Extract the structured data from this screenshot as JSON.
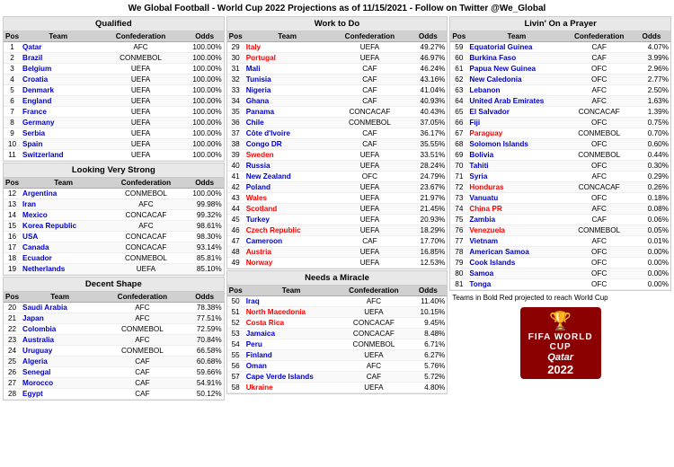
{
  "title": "We Global Football - World Cup 2022 Projections as of 11/15/2021 - Follow on Twitter @We_Global",
  "sections": {
    "qualified": {
      "header": "Qualified",
      "columns": [
        "Pos",
        "Team",
        "Confederation",
        "Odds"
      ],
      "rows": [
        [
          1,
          "Qatar",
          "AFC",
          "100.00%"
        ],
        [
          2,
          "Brazil",
          "CONMEBOL",
          "100.00%"
        ],
        [
          3,
          "Belgium",
          "UEFA",
          "100.00%"
        ],
        [
          4,
          "Croatia",
          "UEFA",
          "100.00%"
        ],
        [
          5,
          "Denmark",
          "UEFA",
          "100.00%"
        ],
        [
          6,
          "England",
          "UEFA",
          "100.00%"
        ],
        [
          7,
          "France",
          "UEFA",
          "100.00%"
        ],
        [
          8,
          "Germany",
          "UEFA",
          "100.00%"
        ],
        [
          9,
          "Serbia",
          "UEFA",
          "100.00%"
        ],
        [
          10,
          "Spain",
          "UEFA",
          "100.00%"
        ],
        [
          11,
          "Switzerland",
          "UEFA",
          "100.00%"
        ]
      ]
    },
    "looking_very_strong": {
      "header": "Looking Very Strong",
      "columns": [
        "Pos",
        "Team",
        "Confederation",
        "Odds"
      ],
      "rows": [
        [
          12,
          "Argentina",
          "CONMEBOL",
          "100.00%"
        ],
        [
          13,
          "Iran",
          "AFC",
          "99.98%"
        ],
        [
          14,
          "Mexico",
          "CONCACAF",
          "99.32%"
        ],
        [
          15,
          "Korea Republic",
          "AFC",
          "98.61%"
        ],
        [
          16,
          "USA",
          "CONCACAF",
          "98.30%"
        ],
        [
          17,
          "Canada",
          "CONCACAF",
          "93.14%"
        ],
        [
          18,
          "Ecuador",
          "CONMEBOL",
          "85.81%"
        ],
        [
          19,
          "Netherlands",
          "UEFA",
          "85.10%"
        ]
      ]
    },
    "decent_shape": {
      "header": "Decent Shape",
      "columns": [
        "Pos",
        "Team",
        "Confederation",
        "Odds"
      ],
      "rows": [
        [
          20,
          "Saudi Arabia",
          "AFC",
          "78.38%"
        ],
        [
          21,
          "Japan",
          "AFC",
          "77.51%"
        ],
        [
          22,
          "Colombia",
          "CONMEBOL",
          "72.59%"
        ],
        [
          23,
          "Australia",
          "AFC",
          "70.84%"
        ],
        [
          24,
          "Uruguay",
          "CONMEBOL",
          "66.58%"
        ],
        [
          25,
          "Algeria",
          "CAF",
          "60.68%"
        ],
        [
          26,
          "Senegal",
          "CAF",
          "59.66%"
        ],
        [
          27,
          "Morocco",
          "CAF",
          "54.91%"
        ],
        [
          28,
          "Egypt",
          "CAF",
          "50.12%"
        ]
      ]
    },
    "work_to_do": {
      "header": "Work to Do",
      "columns": [
        "Pos",
        "Team",
        "Confederation",
        "Odds"
      ],
      "rows": [
        [
          29,
          "Italy",
          "UEFA",
          "49.27%"
        ],
        [
          30,
          "Portugal",
          "UEFA",
          "46.97%"
        ],
        [
          31,
          "Mali",
          "CAF",
          "46.24%"
        ],
        [
          32,
          "Tunisia",
          "CAF",
          "43.16%"
        ],
        [
          33,
          "Nigeria",
          "CAF",
          "41.04%"
        ],
        [
          34,
          "Ghana",
          "CAF",
          "40.93%"
        ],
        [
          35,
          "Panama",
          "CONCACAF",
          "40.43%"
        ],
        [
          36,
          "Chile",
          "CONMEBOL",
          "37.05%"
        ],
        [
          37,
          "Côte d'Ivoire",
          "CAF",
          "36.17%"
        ],
        [
          38,
          "Congo DR",
          "CAF",
          "35.55%"
        ],
        [
          39,
          "Sweden",
          "UEFA",
          "33.51%"
        ],
        [
          40,
          "Russia",
          "UEFA",
          "28.24%"
        ],
        [
          41,
          "New Zealand",
          "OFC",
          "24.79%"
        ],
        [
          42,
          "Poland",
          "UEFA",
          "23.67%"
        ],
        [
          43,
          "Wales",
          "UEFA",
          "21.97%"
        ],
        [
          44,
          "Scotland",
          "UEFA",
          "21.45%"
        ],
        [
          45,
          "Turkey",
          "UEFA",
          "20.93%"
        ],
        [
          46,
          "Czech Republic",
          "UEFA",
          "18.29%"
        ],
        [
          47,
          "Cameroon",
          "CAF",
          "17.70%"
        ],
        [
          48,
          "Austria",
          "UEFA",
          "16.85%"
        ],
        [
          49,
          "Norway",
          "UEFA",
          "12.53%"
        ]
      ]
    },
    "needs_miracle": {
      "header": "Needs a Miracle",
      "columns": [
        "Pos",
        "Team",
        "Confederation",
        "Odds"
      ],
      "rows": [
        [
          50,
          "Iraq",
          "AFC",
          "11.40%"
        ],
        [
          51,
          "North Macedonia",
          "UEFA",
          "10.15%"
        ],
        [
          52,
          "Costa Rica",
          "CONCACAF",
          "9.45%"
        ],
        [
          53,
          "Jamaica",
          "CONCACAF",
          "8.48%"
        ],
        [
          54,
          "Peru",
          "CONMEBOL",
          "6.71%"
        ],
        [
          55,
          "Finland",
          "UEFA",
          "6.27%"
        ],
        [
          56,
          "Oman",
          "AFC",
          "5.76%"
        ],
        [
          57,
          "Cape Verde Islands",
          "CAF",
          "5.72%"
        ],
        [
          58,
          "Ukraine",
          "UEFA",
          "4.80%"
        ]
      ]
    },
    "livin_on_prayer": {
      "header": "Livin' On a Prayer",
      "columns": [
        "Pos",
        "Team",
        "Confederation",
        "Odds"
      ],
      "rows": [
        [
          59,
          "Equatorial Guinea",
          "CAF",
          "4.07%"
        ],
        [
          60,
          "Burkina Faso",
          "CAF",
          "3.99%"
        ],
        [
          61,
          "Papua New Guinea",
          "OFC",
          "2.96%"
        ],
        [
          62,
          "New Caledonia",
          "OFC",
          "2.77%"
        ],
        [
          63,
          "Lebanon",
          "AFC",
          "2.50%"
        ],
        [
          64,
          "United Arab Emirates",
          "AFC",
          "1.63%"
        ],
        [
          65,
          "El Salvador",
          "CONCACAF",
          "1.39%"
        ],
        [
          66,
          "Fiji",
          "OFC",
          "0.75%"
        ],
        [
          67,
          "Paraguay",
          "CONMEBOL",
          "0.70%"
        ],
        [
          68,
          "Solomon Islands",
          "OFC",
          "0.60%"
        ],
        [
          69,
          "Bolivia",
          "CONMEBOL",
          "0.44%"
        ],
        [
          70,
          "Tahiti",
          "OFC",
          "0.30%"
        ],
        [
          71,
          "Syria",
          "AFC",
          "0.29%"
        ],
        [
          72,
          "Honduras",
          "CONCACAF",
          "0.26%"
        ],
        [
          73,
          "Vanuatu",
          "OFC",
          "0.18%"
        ],
        [
          74,
          "China PR",
          "AFC",
          "0.08%"
        ],
        [
          75,
          "Zambia",
          "CAF",
          "0.06%"
        ],
        [
          76,
          "Venezuela",
          "CONMEBOL",
          "0.05%"
        ],
        [
          77,
          "Vietnam",
          "AFC",
          "0.01%"
        ],
        [
          78,
          "American Samoa",
          "OFC",
          "0.00%"
        ],
        [
          79,
          "Cook Islands",
          "OFC",
          "0.00%"
        ],
        [
          80,
          "Samoa",
          "OFC",
          "0.00%"
        ],
        [
          81,
          "Tonga",
          "OFC",
          "0.00%"
        ]
      ]
    }
  },
  "note": "Teams in Bold Red projected to reach World Cup",
  "logo": {
    "line1": "FIFA WORLD CUP",
    "line2": "Qatar 2022"
  }
}
